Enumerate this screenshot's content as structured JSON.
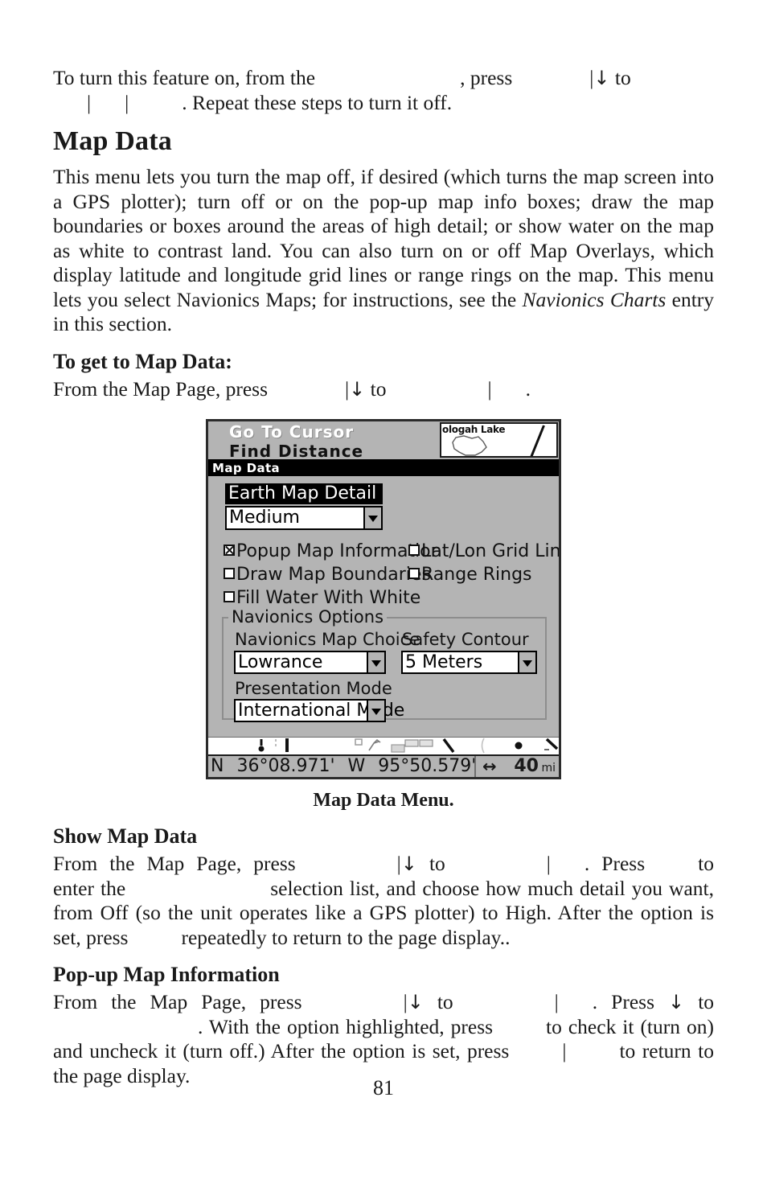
{
  "page": {
    "number": "81",
    "section_title": "Map Data",
    "caption": "Map Data Menu."
  },
  "intro": {
    "line1_a": "To turn this feature on, from the",
    "line1_b": ", press",
    "line1_c": "to",
    "line2_a": ".",
    "line2_b": "Repeat these steps to turn it off.",
    "pipe": "|",
    "down_arrow": "↓"
  },
  "overview": {
    "paragraph": "This menu lets you turn the map off, if desired (which turns the map screen into a GPS plotter); turn off or on the pop-up map info boxes; draw the map boundaries or boxes around the areas of high detail; or show water on the map as white to contrast land. You can also turn on or off Map Overlays, which display latitude and longitude grid lines or range rings on the map. This menu lets you select Navionics Maps; for instructions, see the",
    "italic_ref": "Navionics Charts",
    "paragraph_tail": "entry in this section."
  },
  "get_to": {
    "heading": "To get to Map Data:",
    "line_a": "From the Map Page, press",
    "line_b": "to",
    "line_c": "."
  },
  "show_map_data": {
    "heading": "Show Map Data",
    "t1": "From the Map Page, press",
    "t2": "to",
    "t3": ". Press",
    "t4": "to enter the",
    "t5": "selection list, and choose how much detail you want, from Off (so the unit operates like a GPS plotter) to High. After the option is set, press",
    "t6": "repeatedly to return to the page display.."
  },
  "popup_map_info": {
    "heading": "Pop-up Map Information",
    "t1": "From the Map Page, press",
    "t2": "to",
    "t3": ". Press",
    "t4": "to",
    "t5": ". With the option highlighted, press",
    "t6": "to check it (turn on) and uncheck it (turn off.) After the option is set, press",
    "t7": "to return to the page display."
  },
  "device": {
    "background_menu": {
      "item1": "Go To Cursor",
      "item2": "Find Distance"
    },
    "minimap": {
      "lake_label": "ologah Lake"
    },
    "titlebar": {
      "title": "Map Data"
    },
    "earth_map_detail": {
      "label": "Earth Map Detail",
      "value": "Medium"
    },
    "checkboxes": [
      {
        "label": "Popup Map Information",
        "checked": true
      },
      {
        "label": "Lat/Lon Grid Lines",
        "checked": false
      },
      {
        "label": "Draw Map Boundaries",
        "checked": false
      },
      {
        "label": "Range Rings",
        "checked": false
      },
      {
        "label": "Fill Water With White",
        "checked": false
      }
    ],
    "navionics": {
      "group_title": "Navionics Options",
      "map_choice_label": "Navionics Map Choice",
      "map_choice_value": "Lowrance",
      "safety_contour_label": "Safety Contour",
      "safety_contour_value": "5 Meters",
      "presentation_label": "Presentation Mode",
      "presentation_value": "International Mode"
    },
    "status": {
      "lat_hemi": "N",
      "lat": "36°08.971'",
      "lon_hemi": "W",
      "lon": "95°50.579'",
      "range_icon": "↔",
      "range_value": "40",
      "range_unit": "mi"
    },
    "colors": {
      "screen_gray": "#b4b4b4",
      "bezel": "#2b2b2b",
      "titlebar": "#000000",
      "field_white": "#ffffff"
    }
  }
}
